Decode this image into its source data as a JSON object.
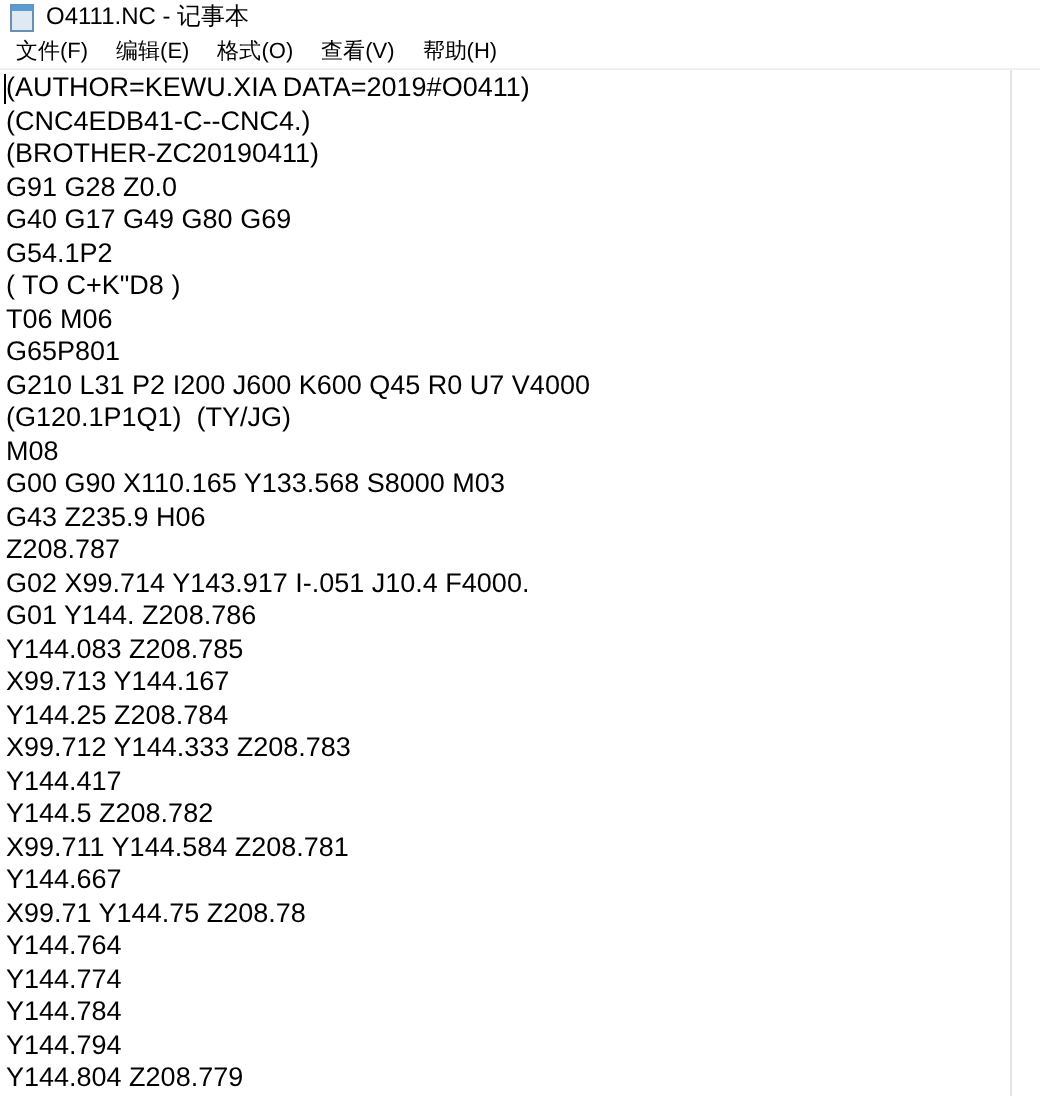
{
  "window": {
    "title": "O4111.NC - 记事本"
  },
  "menu": [
    {
      "label": "文件(F)"
    },
    {
      "label": "编辑(E)"
    },
    {
      "label": "格式(O)"
    },
    {
      "label": "查看(V)"
    },
    {
      "label": "帮助(H)"
    }
  ],
  "editor": {
    "lines": [
      "(AUTHOR=KEWU.XIA DATA=2019#O0411)",
      "(CNC4EDB41-C--CNC4.)",
      "(BROTHER-ZC20190411)",
      "G91 G28 Z0.0",
      "G40 G17 G49 G80 G69",
      "G54.1P2",
      "( TO C+K\"D8 )",
      "T06 M06",
      "G65P801",
      "G210 L31 P2 I200 J600 K600 Q45 R0 U7 V4000",
      "(G120.1P1Q1)  (TY/JG)",
      "M08",
      "G00 G90 X110.165 Y133.568 S8000 M03",
      "G43 Z235.9 H06",
      "Z208.787",
      "G02 X99.714 Y143.917 I-.051 J10.4 F4000.",
      "G01 Y144. Z208.786",
      "Y144.083 Z208.785",
      "X99.713 Y144.167",
      "Y144.25 Z208.784",
      "X99.712 Y144.333 Z208.783",
      "Y144.417",
      "Y144.5 Z208.782",
      "X99.711 Y144.584 Z208.781",
      "Y144.667",
      "X99.71 Y144.75 Z208.78",
      "Y144.764",
      "Y144.774",
      "Y144.784",
      "Y144.794",
      "Y144.804 Z208.779"
    ]
  }
}
